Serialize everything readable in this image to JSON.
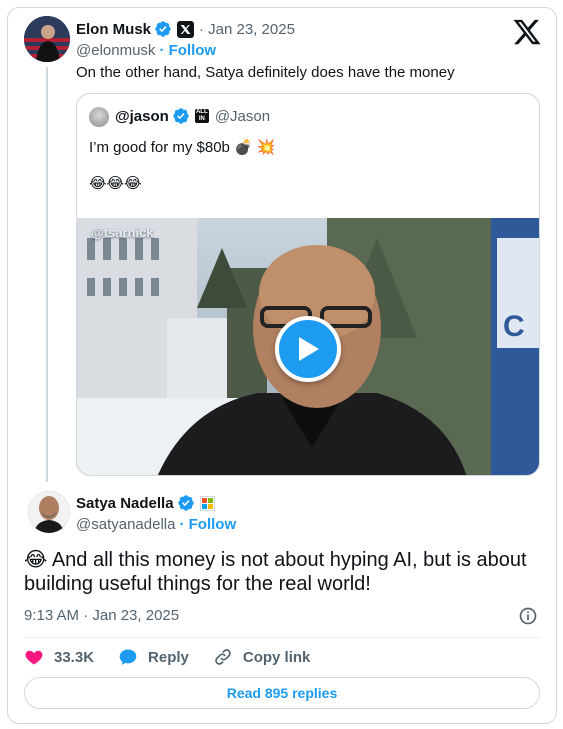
{
  "parent_tweet": {
    "display_name": "Elon Musk",
    "handle": "@elonmusk",
    "date": "· Jan 23, 2025",
    "follow_label": "· Follow",
    "text": "On the other hand, Satya definitely does have the money"
  },
  "quote_tweet": {
    "display_name": "@jason",
    "handle": "@Jason",
    "badge_text": [
      "ALL",
      "IN"
    ],
    "text": "I’m good for my $80b 💣 💥",
    "emojis": "😂😂😂",
    "video_watermark": "@tsarnick"
  },
  "reply_tweet": {
    "display_name": "Satya Nadella",
    "handle": "@satyanadella",
    "follow_label": "· Follow",
    "text": "😂 And all this money is not about hyping AI, but is about building useful things for the real world!",
    "timestamp": "9:13 AM · Jan 23, 2025"
  },
  "actions": {
    "likes": "33.3K",
    "reply": "Reply",
    "copy_link": "Copy link"
  },
  "read_replies": "Read 895 replies",
  "colors": {
    "accent": "#1d9bf0",
    "heart": "#f91880",
    "text": "#0f1419",
    "muted": "#536471",
    "border": "#cfd9de"
  },
  "icons": [
    "x-logo-icon",
    "verified-icon",
    "government-badge-icon",
    "all-in-badge-icon",
    "microsoft-badge-icon",
    "play-icon",
    "info-icon",
    "heart-icon",
    "reply-icon",
    "link-icon"
  ]
}
